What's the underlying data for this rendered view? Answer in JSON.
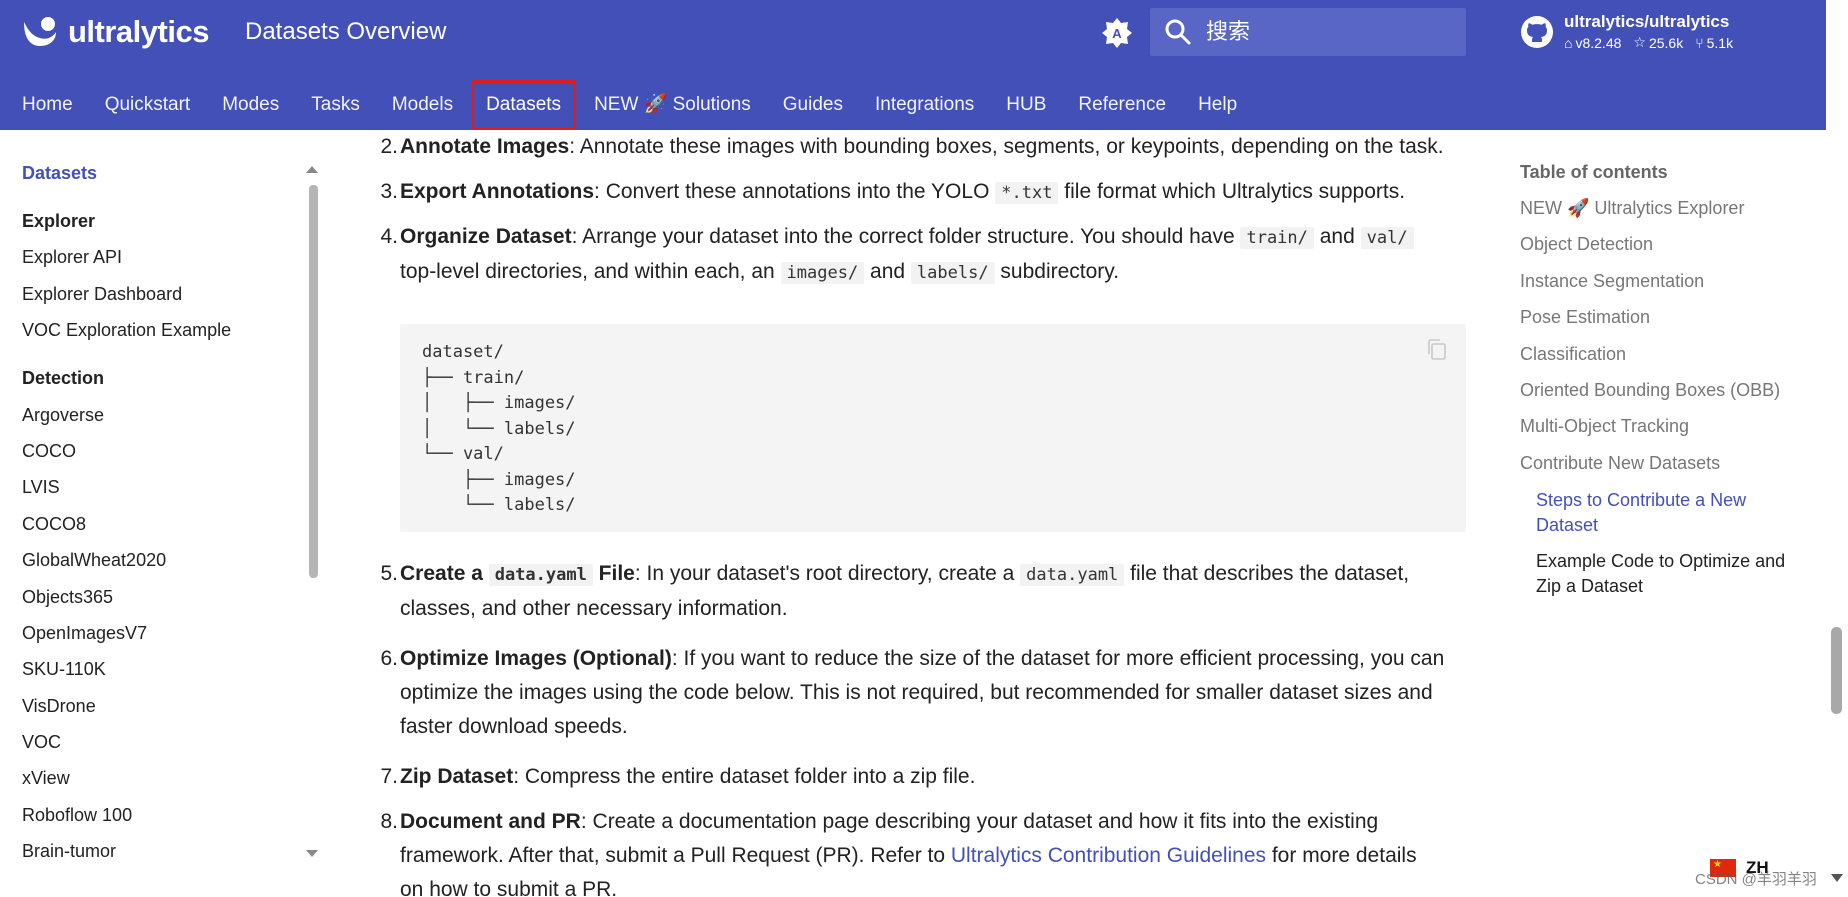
{
  "header": {
    "logo_text": "ultralytics",
    "site_title": "Datasets Overview",
    "search_placeholder": "搜索",
    "repo": {
      "name": "ultralytics/ultralytics",
      "version": "v8.2.48",
      "stars": "25.6k",
      "forks": "5.1k"
    },
    "theme_icon": "auto-theme-icon"
  },
  "tabs": [
    {
      "label": "Home"
    },
    {
      "label": "Quickstart"
    },
    {
      "label": "Modes"
    },
    {
      "label": "Tasks"
    },
    {
      "label": "Models"
    },
    {
      "label": "Datasets"
    },
    {
      "label": "NEW 🚀 Solutions"
    },
    {
      "label": "Guides"
    },
    {
      "label": "Integrations"
    },
    {
      "label": "HUB"
    },
    {
      "label": "Reference"
    },
    {
      "label": "Help"
    }
  ],
  "sidebar": {
    "items": [
      {
        "label": "Datasets"
      },
      {
        "label": "Explorer"
      },
      {
        "label": "Explorer API"
      },
      {
        "label": "Explorer Dashboard"
      },
      {
        "label": "VOC Exploration Example"
      },
      {
        "label": "Detection"
      },
      {
        "label": "Argoverse"
      },
      {
        "label": "COCO"
      },
      {
        "label": "LVIS"
      },
      {
        "label": "COCO8"
      },
      {
        "label": "GlobalWheat2020"
      },
      {
        "label": "Objects365"
      },
      {
        "label": "OpenImagesV7"
      },
      {
        "label": "SKU-110K"
      },
      {
        "label": "VisDrone"
      },
      {
        "label": "VOC"
      },
      {
        "label": "xView"
      },
      {
        "label": "Roboflow 100"
      },
      {
        "label": "Brain-tumor"
      }
    ]
  },
  "content": {
    "step2": {
      "num": "2.",
      "bold": "Annotate Images",
      "rest": ": Annotate these images with bounding boxes, segments, or keypoints, depending on the task."
    },
    "step3": {
      "num": "3.",
      "bold": "Export Annotations",
      "pre": ": Convert these annotations into the YOLO ",
      "code": "*.txt",
      "post": " file format which Ultralytics supports."
    },
    "step4": {
      "num": "4.",
      "bold": "Organize Dataset",
      "pre": ": Arrange your dataset into the correct folder structure. You should have ",
      "code1": "train/",
      "mid1": " and ",
      "code2": "val/",
      "line2_pre": "top-level directories, and within each, an ",
      "code3": "images/",
      "mid2": " and ",
      "code4": "labels/",
      "post": " subdirectory."
    },
    "code_block": "dataset/\n├── train/\n│   ├── images/\n│   └── labels/\n└── val/\n    ├── images/\n    └── labels/",
    "step5": {
      "num": "5.",
      "bold_pre": "Create a ",
      "bold_code": "data.yaml",
      "bold_post": " File",
      "pre": ": In your dataset's root directory, create a ",
      "code": "data.yaml",
      "post": " file that describes the dataset,",
      "line2": "classes, and other necessary information."
    },
    "step6": {
      "num": "6.",
      "bold": "Optimize Images (Optional)",
      "rest": ": If you want to reduce the size of the dataset for more efficient processing, you can",
      "line2": "optimize the images using the code below. This is not required, but recommended for smaller dataset sizes and",
      "line3": "faster download speeds."
    },
    "step7": {
      "num": "7.",
      "bold": "Zip Dataset",
      "rest": ": Compress the entire dataset folder into a zip file."
    },
    "step8": {
      "num": "8.",
      "bold": "Document and PR",
      "rest": ": Create a documentation page describing your dataset and how it fits into the existing",
      "line2_pre": "framework. After that, submit a Pull Request (PR). Refer to ",
      "link": "Ultralytics Contribution Guidelines",
      "line2_post": " for more details",
      "line3": "on how to submit a PR."
    }
  },
  "toc": {
    "title": "Table of contents",
    "items": [
      {
        "label": "NEW 🚀 Ultralytics Explorer"
      },
      {
        "label": "Object Detection"
      },
      {
        "label": "Instance Segmentation"
      },
      {
        "label": "Pose Estimation"
      },
      {
        "label": "Classification"
      },
      {
        "label": "Oriented Bounding Boxes (OBB)"
      },
      {
        "label": "Multi-Object Tracking"
      },
      {
        "label": "Contribute New Datasets"
      }
    ],
    "sub_items": [
      {
        "line1": "Steps to Contribute a New",
        "line2": "Dataset"
      },
      {
        "line1": "Example Code to Optimize and",
        "line2": "Zip a Dataset"
      }
    ]
  },
  "footer": {
    "lang_code": "ZH",
    "watermark": "CSDN @羊羽羊羽"
  },
  "colors": {
    "header_bg": "#4350b8",
    "accent": "#4350b8",
    "active_tab_outline": "#e21b1b"
  }
}
